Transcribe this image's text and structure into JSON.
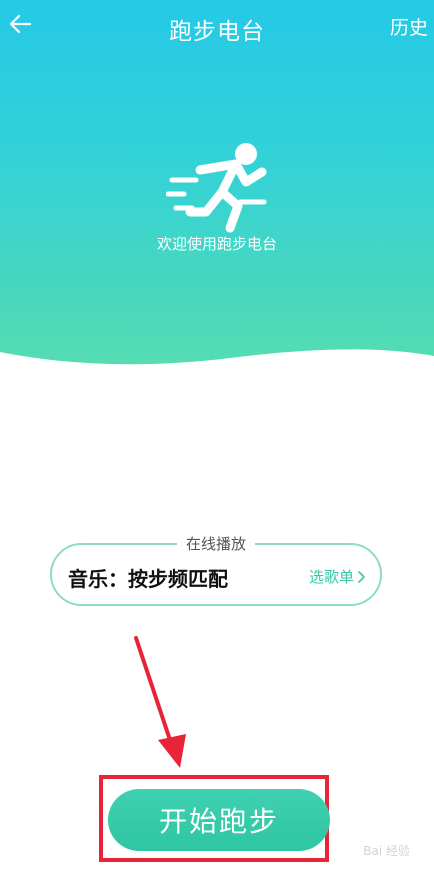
{
  "header": {
    "title": "跑步电台",
    "history_label": "历史",
    "back_icon": "arrow-left-icon"
  },
  "hero": {
    "welcome_text": "欢迎使用跑步电台",
    "runner_icon": "running-person-icon",
    "gradient_top": "#24c9e6",
    "gradient_bottom": "#58ddb0"
  },
  "online_card": {
    "caption": "在线播放",
    "music_label": "音乐：按步频匹配",
    "playlist_label": "选歌单",
    "playlist_icon": "chevron-right-icon",
    "accent_color": "#3cc6a8"
  },
  "start": {
    "label": "开始跑步",
    "color": "#2fc6a2"
  },
  "annotation": {
    "color": "#e8243a"
  },
  "watermark": {
    "text": "Bai 经验"
  }
}
